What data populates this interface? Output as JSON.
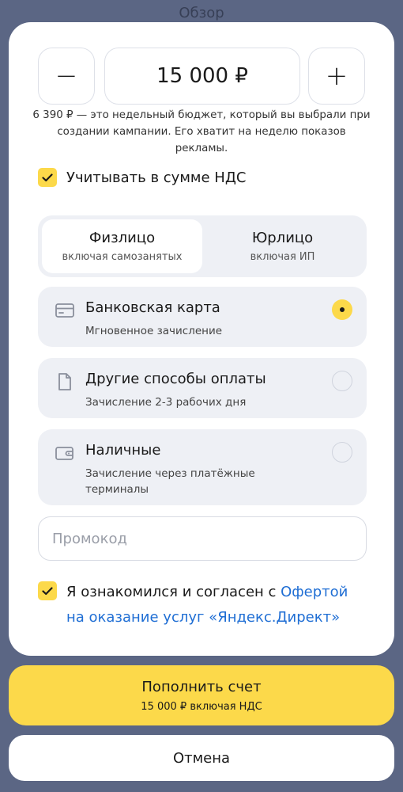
{
  "background_title": "Обзор",
  "stepper": {
    "minus_label": "−",
    "plus_label": "+",
    "amount": "15 000 ₽"
  },
  "hint": "6 390 ₽ — это недельный бюджет, который вы выбрали при создании кампании. Его хватит на неделю показов рекламы.",
  "vat_checkbox": {
    "label": "Учитывать в сумме НДС",
    "checked": true
  },
  "payer_type": {
    "options": [
      {
        "title": "Физлицо",
        "subtitle": "включая самозанятых",
        "selected": true
      },
      {
        "title": "Юрлицо",
        "subtitle": "включая ИП",
        "selected": false
      }
    ]
  },
  "payment_methods": [
    {
      "icon": "card-icon",
      "title": "Банковская карта",
      "subtitle": "Мгновенное зачисление",
      "selected": true
    },
    {
      "icon": "document-icon",
      "title": "Другие способы оплаты",
      "subtitle": "Зачисление 2-3 рабочих дня",
      "selected": false
    },
    {
      "icon": "wallet-icon",
      "title": "Наличные",
      "subtitle": "Зачисление через платёжные терминалы",
      "selected": false
    }
  ],
  "promo": {
    "placeholder": "Промокод",
    "value": ""
  },
  "agreement": {
    "checked": true,
    "text": "Я ознакомился и согласен с ",
    "link": "Офертой на оказание услуг «Яндекс.Директ»"
  },
  "pay_button": {
    "label": "Пополнить счет",
    "sublabel": "15 000 ₽ включая НДС"
  },
  "cancel_button": {
    "label": "Отмена"
  },
  "colors": {
    "accent": "#fcd94a",
    "link": "#1f6ed4",
    "card_bg": "#eef0f5",
    "backdrop": "#5b6684"
  }
}
